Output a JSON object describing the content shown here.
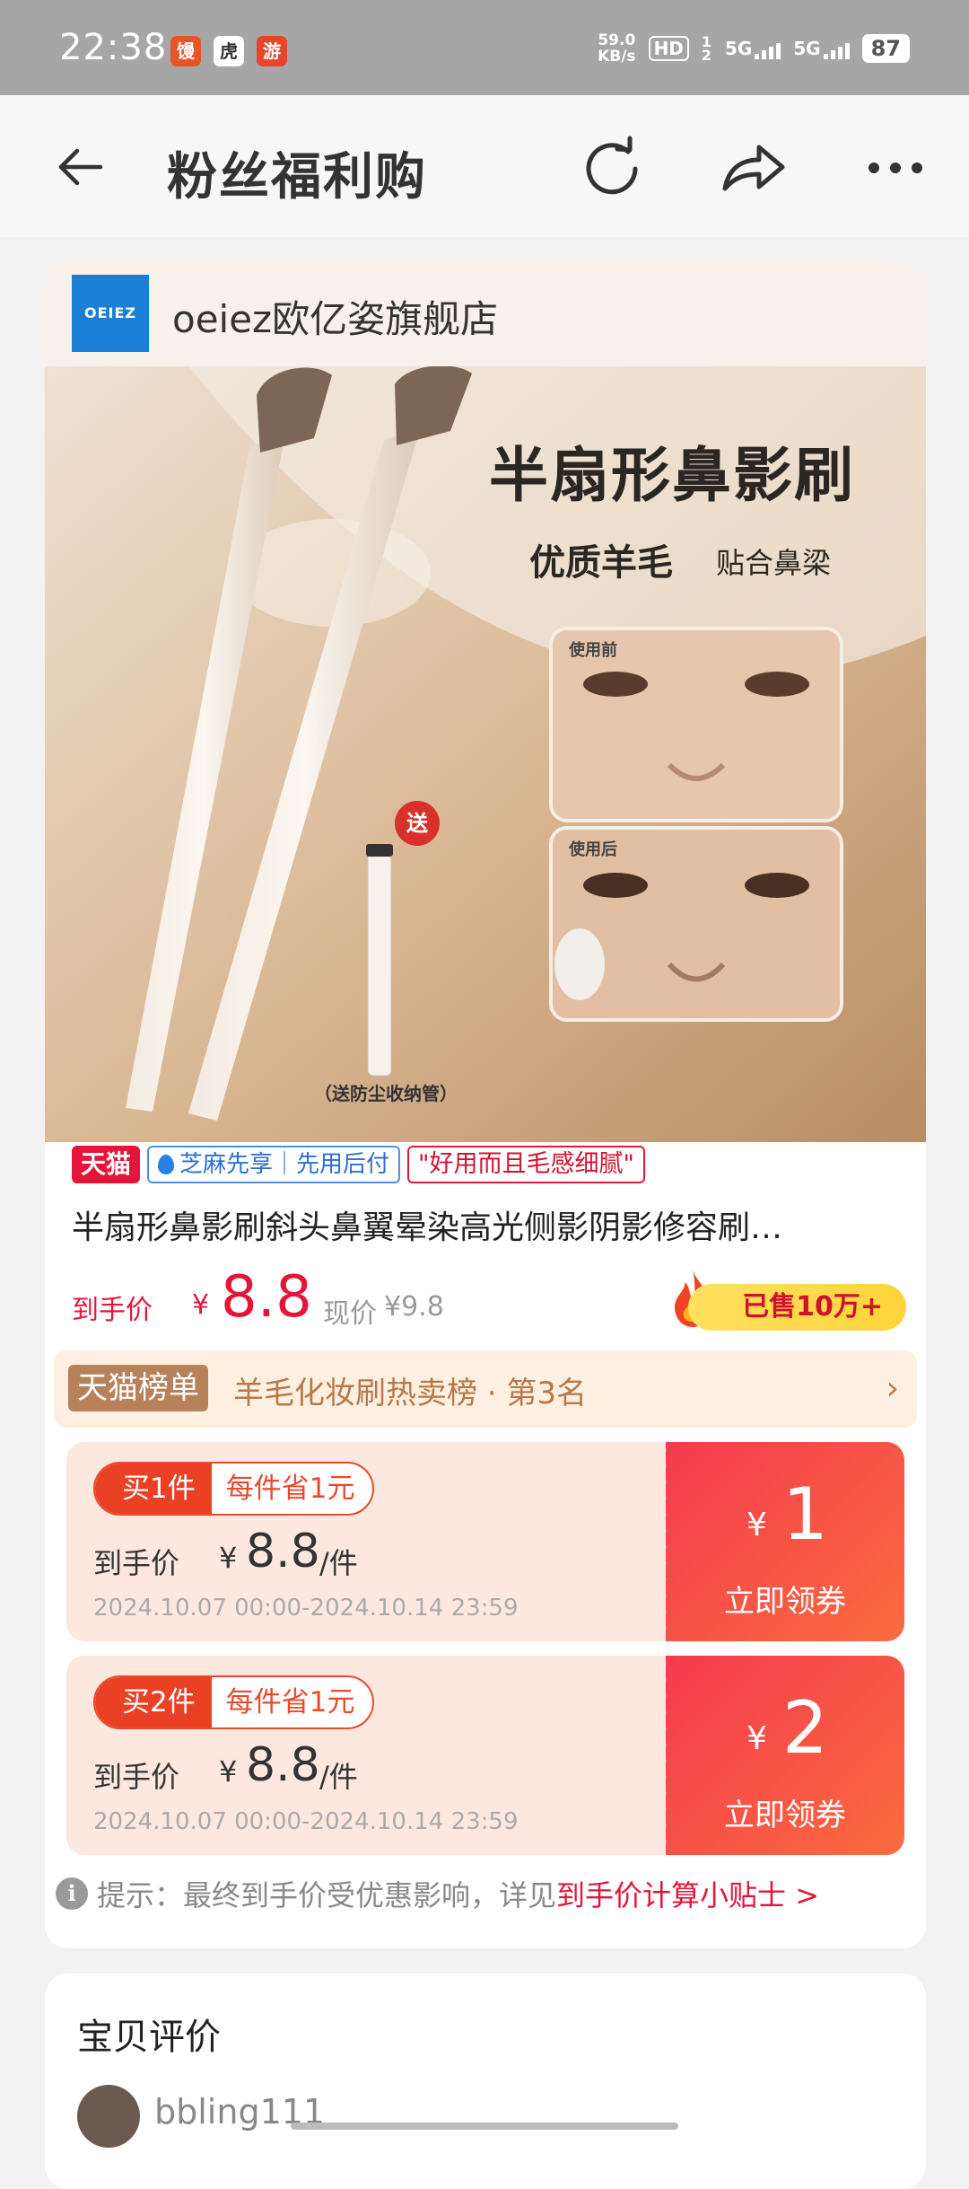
{
  "status_bar": {
    "time": "22:38",
    "app_icons": [
      "馒",
      "虎",
      "游"
    ],
    "speed": "59.0",
    "speed_unit": "KB/s",
    "hd": "HD",
    "sim": "1 2",
    "net1": "5G",
    "net2": "5G",
    "battery": "87"
  },
  "header": {
    "title": "粉丝福利购"
  },
  "store": {
    "logo_text": "OEIEZ",
    "name": "oeiez欧亿姿旗舰店"
  },
  "hero": {
    "headline": "半扇形鼻影刷",
    "sub1": "优质羊毛",
    "sub2": "贴合鼻梁",
    "before_label": "使用前",
    "after_label": "使用后",
    "gift_badge": "送",
    "tube_caption": "（送防尘收纳管）"
  },
  "badges": {
    "tmall": "天猫",
    "zhima": "芝麻先享｜先用后付",
    "quote": "\"好用而且毛感细腻\""
  },
  "product": {
    "title": "半扇形鼻影刷斜头鼻翼晕染高光侧影阴影修容刷…",
    "final_price_label": "到手价",
    "currency": "¥",
    "final_price": "8.8",
    "current_price_label": "现价",
    "current_price": "¥9.8",
    "sold": "已售10万+"
  },
  "rank": {
    "tag": "天猫榜单",
    "text": "羊毛化妆刷热卖榜 · 第3名",
    "chevron": "›"
  },
  "coupons": [
    {
      "qty": "买1件",
      "saving": "每件省1元",
      "price_label": "到手价",
      "currency": "¥",
      "price": "8.8",
      "unit": "/件",
      "period": "2024.10.07 00:00-2024.10.14 23:59",
      "amount_currency": "¥",
      "amount": "1",
      "claim": "立即领券"
    },
    {
      "qty": "买2件",
      "saving": "每件省1元",
      "price_label": "到手价",
      "currency": "¥",
      "price": "8.8",
      "unit": "/件",
      "period": "2024.10.07 00:00-2024.10.14 23:59",
      "amount_currency": "¥",
      "amount": "2",
      "claim": "立即领券"
    }
  ],
  "tip": {
    "icon": "i",
    "text": "提示：最终到手价受优惠影响，详见",
    "link": "到手价计算小贴士 >"
  },
  "reviews": {
    "title": "宝贝评价",
    "first_user": "bbling111"
  },
  "colors": {
    "accent": "#e4153a",
    "coupon_bg": "#fce8df",
    "coupon_right": "#f53b4e",
    "rank_bg": "#fdf0e0",
    "status_bar": "#a6a6a6"
  }
}
